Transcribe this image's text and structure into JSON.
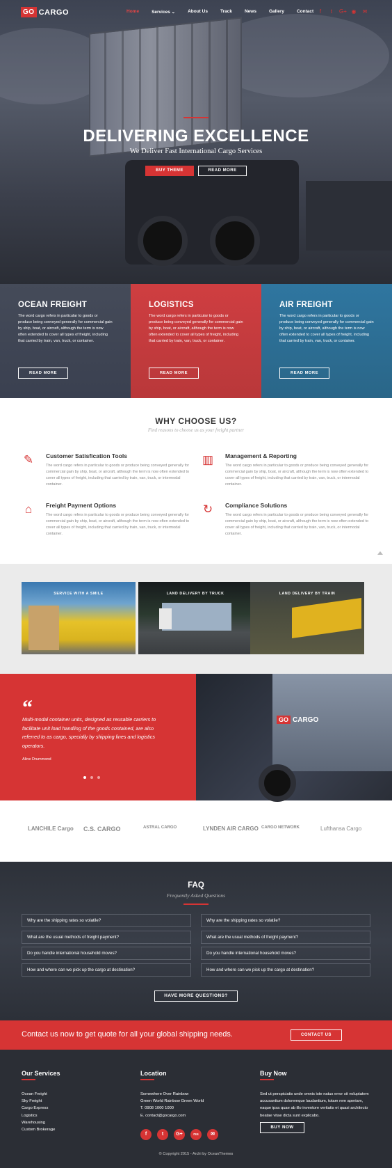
{
  "nav": {
    "logo_go": "GO",
    "logo_cargo": "CARGO",
    "items": [
      {
        "label": "Home",
        "active": true
      },
      {
        "label": "Services ⌄",
        "active": false
      },
      {
        "label": "About Us",
        "active": false
      },
      {
        "label": "Track",
        "active": false
      },
      {
        "label": "News",
        "active": false
      },
      {
        "label": "Gallery",
        "active": false
      },
      {
        "label": "Contact",
        "active": false
      }
    ],
    "social_icons": [
      "facebook-icon",
      "twitter-icon",
      "google-plus-icon",
      "rss-icon",
      "mail-icon"
    ]
  },
  "hero": {
    "title": "DELIVERING EXCELLENCE",
    "subtitle": "We Deliver Fast International Cargo Services",
    "btn_primary": "BUY THEME",
    "btn_secondary": "READ MORE"
  },
  "services": [
    {
      "title": "OCEAN FREIGHT",
      "text": "The word cargo refers in particular to goods or produce being conveyed generally for commercial gain by ship, boat, or aircraft, although the term is now often extended to cover all types of freight, including that carried by train, van, truck, or container.",
      "button": "READ MORE",
      "color": "#3a4150"
    },
    {
      "title": "LOGISTICS",
      "text": "The word cargo refers in particular to goods or produce being conveyed generally for commercial gain by ship, boat, or aircraft, although the term is now often extended to cover all types of freight, including that carried by train, van, truck, or container.",
      "button": "READ MORE",
      "color": "#c93a3d"
    },
    {
      "title": "AIR FREIGHT",
      "text": "The word cargo refers in particular to goods or produce being conveyed generally for commercial gain by ship, boat, or aircraft, although the term is now often extended to cover all types of freight, including that carried by train, van, truck, or container.",
      "button": "READ MORE",
      "color": "#2d6f92"
    }
  ],
  "why": {
    "title": "WHY CHOOSE US?",
    "subtitle": "Find reasons to choose us as your freight partner",
    "features": [
      {
        "icon": "pencil-ruler-icon",
        "glyph": "✎",
        "title": "Customer Satisfication Tools",
        "text": "The word cargo refers in particular to goods or produce being conveyed generally for commercial gain by ship, boat, or aircraft, although the term is now often extended to cover all types of freight, including that carried by train, van, truck, or intermodal container."
      },
      {
        "icon": "bar-chart-icon",
        "glyph": "▥",
        "title": "Management & Reporting",
        "text": "The word cargo refers in particular to goods or produce being conveyed generally for commercial gain by ship, boat, or aircraft, although the term is now often extended to cover all types of freight, including that carried by train, van, truck, or intermodal container."
      },
      {
        "icon": "tag-icon",
        "glyph": "⌂",
        "title": "Freight Payment Options",
        "text": "The word cargo refers in particular to goods or produce being conveyed generally for commercial gain by ship, boat, or aircraft, although the term is now often extended to cover all types of freight, including that carried by train, van, truck, or intermodal container."
      },
      {
        "icon": "refresh-icon",
        "glyph": "↻",
        "title": "Compliance Solutions",
        "text": "The word cargo refers in particular to goods or produce being conveyed generally for commercial gain by ship, boat, or aircraft, although the term is now often extended to cover all types of freight, including that carried by train, van, truck, or intermodal container."
      }
    ]
  },
  "gallery": [
    {
      "caption": "SERVICE WITH A SMILE"
    },
    {
      "caption": "LAND DELIVERY BY TRUCK"
    },
    {
      "caption": "LAND DELIVERY BY TRAIN"
    }
  ],
  "testimonial": {
    "quote": "Multi-modal container units, designed as reusable carriers to facilitate unit load handling of the goods contained, are also referred to as cargo, specially by shipping lines and logistics operators.",
    "author": "Aline Drummond",
    "truck_logo_go": "GO",
    "truck_logo_cargo": "CARGO"
  },
  "partners": [
    "LANCHILE Cargo",
    "C.S. CARGO",
    "ASTRAL CARGO",
    "LYNDEN AIR CARGO",
    "CARGO NETWORK",
    "Lufthansa Cargo"
  ],
  "faq": {
    "title": "FAQ",
    "subtitle": "Frequently Asked Questions",
    "left": [
      "Why are the shipping rates so volatile?",
      "What are the usual methods of freight payment?",
      "Do you handle international household moves?",
      "How and where can we pick up the cargo at destination?"
    ],
    "right": [
      "Why are the shipping rates so volatile?",
      "What are the usual methods of freight payment?",
      "Do you handle international household moves?",
      "How and where can we pick up the cargo at destination?"
    ],
    "button": "HAVE MORE QUESTIONS?"
  },
  "cta": {
    "text": "Contact us now to get quote for all your global shipping needs.",
    "button": "CONTACT US"
  },
  "footer": {
    "services_title": "Our Services",
    "services": [
      "Ocean Freight",
      "Sky Freight",
      "Cargo Express",
      "Logistics",
      "Warehousing",
      "Custom Brokerage"
    ],
    "location_title": "Location",
    "location": [
      "Somewhere Over Rainbow",
      "Green World Rainbow Green World",
      "T. 0908 1000 1000",
      "E. contact@gocargo.com"
    ],
    "buy_title": "Buy Now",
    "buy_text": "Sed ut perspiciatis unde omnis iste natus error sit voluptatem accusantium doloremque laudantium, totam rem aperiam, eaque ipsa quae ab illo inventore veritatis et quasi architecto beatae vitae dicta sunt explicabo.",
    "buy_button": "BUY NOW",
    "social": [
      "f",
      "t",
      "G+",
      "rss",
      "✉"
    ],
    "copyright": "© Copyright 2015 - Archi by OceanThemes"
  },
  "colors": {
    "accent": "#d63434",
    "dark": "#2b2e35"
  }
}
